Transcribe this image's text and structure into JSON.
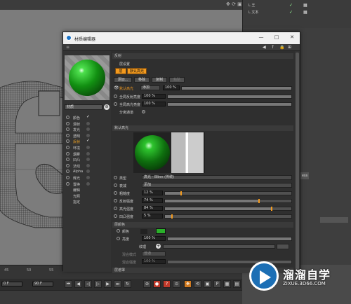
{
  "objmgr": {
    "rows": [
      "L 王",
      "L 文本"
    ]
  },
  "timeline": {
    "ticks": [
      "45",
      "50",
      "55"
    ],
    "frame_field": "0 F",
    "frame_field2": "90 F"
  },
  "dialog": {
    "title": "材质编辑器",
    "win_min": "—",
    "win_max": "□",
    "win_close": "✕",
    "material_name": "材质",
    "channels": [
      {
        "label": "颜色",
        "checked": true
      },
      {
        "label": "漫射",
        "checked": false
      },
      {
        "label": "发光",
        "checked": false
      },
      {
        "label": "透明",
        "checked": false
      },
      {
        "label": "反射",
        "checked": true,
        "active": true
      },
      {
        "label": "环境",
        "checked": false
      },
      {
        "label": "烟雾",
        "checked": false
      },
      {
        "label": "凹凸",
        "checked": false
      },
      {
        "label": "法线",
        "checked": false
      },
      {
        "label": "Alpha",
        "checked": false
      },
      {
        "label": "辉光",
        "checked": false
      },
      {
        "label": "置换",
        "checked": false
      },
      {
        "label": "编辑",
        "checked": null
      },
      {
        "label": "光照",
        "checked": null
      },
      {
        "label": "指定",
        "checked": null
      }
    ],
    "reflect": {
      "header": "反射",
      "layer_settings": "层设置",
      "tab_layer": "层",
      "tab_default": "默认高光",
      "btn_add": "添加...",
      "btn_remove": "移除",
      "btn_copy": "复制",
      "btn_paste": "粘贴",
      "layer_name": "默认高光",
      "blend_mode": "添加",
      "layer_pct": "100 %",
      "global_refl": "全局反射亮度",
      "global_refl_val": "100 %",
      "global_spec": "全局高光亮度",
      "global_spec_val": "100 %",
      "separate": "分离通道",
      "default_hdr": "默认高光",
      "type_lbl": "类型",
      "type_val": "高光 - Blinn (传统)",
      "atten_lbl": "衰减",
      "atten_val": "添加",
      "rough_lbl": "粗糙度",
      "rough_val": "12 %",
      "rough_frac": 0.12,
      "refl_lbl": "反射强度",
      "refl_val": "74 %",
      "refl_frac": 0.74,
      "spec_lbl": "高光强度",
      "spec_val": "84 %",
      "spec_frac": 0.84,
      "bump_lbl": "凹凸强度",
      "bump_val": "5 %",
      "bump_frac": 0.05,
      "layer_color_hdr": "层颜色",
      "color_lbl": "颜色",
      "color_swatch": "#2ab02a",
      "bright_lbl": "亮度",
      "bright_val": "100 %",
      "tex_lbl": "纹理",
      "mix_lbl": "混合模式",
      "mix_val": "普通",
      "mix_str_lbl": "混合强度",
      "mix_str_val": "100 %",
      "layer_mask_hdr": "层遮罩"
    }
  },
  "watermark": {
    "cn": "溜溜自学",
    "url": "ZIXUE.3D66.COM"
  },
  "colors": {
    "accent": "#f39a1e",
    "title_bg": "#f0f0f0"
  }
}
